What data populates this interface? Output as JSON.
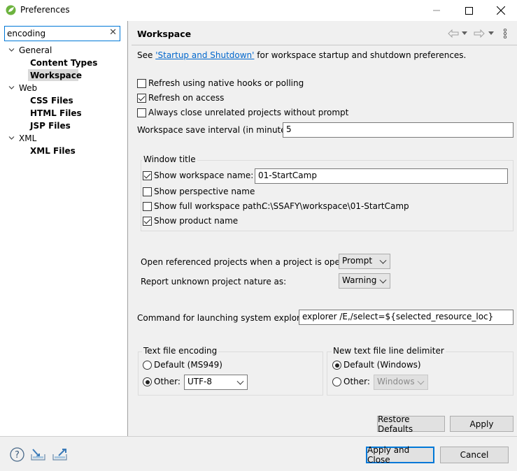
{
  "window": {
    "title": "Preferences"
  },
  "filter": {
    "value": "encoding"
  },
  "tree": [
    {
      "label": "General"
    },
    {
      "label": "Content Types"
    },
    {
      "label": "Workspace"
    },
    {
      "label": "Web"
    },
    {
      "label": "CSS Files"
    },
    {
      "label": "HTML Files"
    },
    {
      "label": "JSP Files"
    },
    {
      "label": "XML"
    },
    {
      "label": "XML Files"
    }
  ],
  "page": {
    "title": "Workspace",
    "see_prefix": "See ",
    "see_link": "'Startup and Shutdown'",
    "see_suffix": " for workspace startup and shutdown preferences.",
    "refresh_native": "Refresh using native hooks or polling",
    "refresh_access": "Refresh on access",
    "always_close": "Always close unrelated projects without prompt",
    "save_interval_label": "Workspace save interval (in minutes):",
    "save_interval_value": "5",
    "window_title_group": "Window title",
    "show_ws_name": "Show workspace name:",
    "ws_name_value": "01-StartCamp",
    "show_perspective": "Show perspective name",
    "show_full_path": "Show full workspace path:",
    "full_path_value": "C:\\SSAFY\\workspace\\01-StartCamp",
    "show_product": "Show product name",
    "open_ref_label": "Open referenced projects when a project is opened:",
    "open_ref_value": "Prompt",
    "report_unknown_label": "Report unknown project nature as:",
    "report_unknown_value": "Warning",
    "cmd_label": "Command for launching system explorer:",
    "cmd_value": "explorer /E,/select=${selected_resource_loc}",
    "encoding_group": "Text file encoding",
    "enc_default": "Default (MS949)",
    "enc_other": "Other:",
    "enc_other_value": "UTF-8",
    "delim_group": "New text file line delimiter",
    "delim_default": "Default (Windows)",
    "delim_other": "Other:",
    "delim_other_value": "Windows",
    "restore_defaults": "Restore Defaults",
    "apply": "Apply"
  },
  "footer": {
    "apply_close": "Apply and Close",
    "cancel": "Cancel"
  },
  "colors": {
    "accent": "#0078d7",
    "link": "#0066cc",
    "panel": "#f0f0f0"
  }
}
